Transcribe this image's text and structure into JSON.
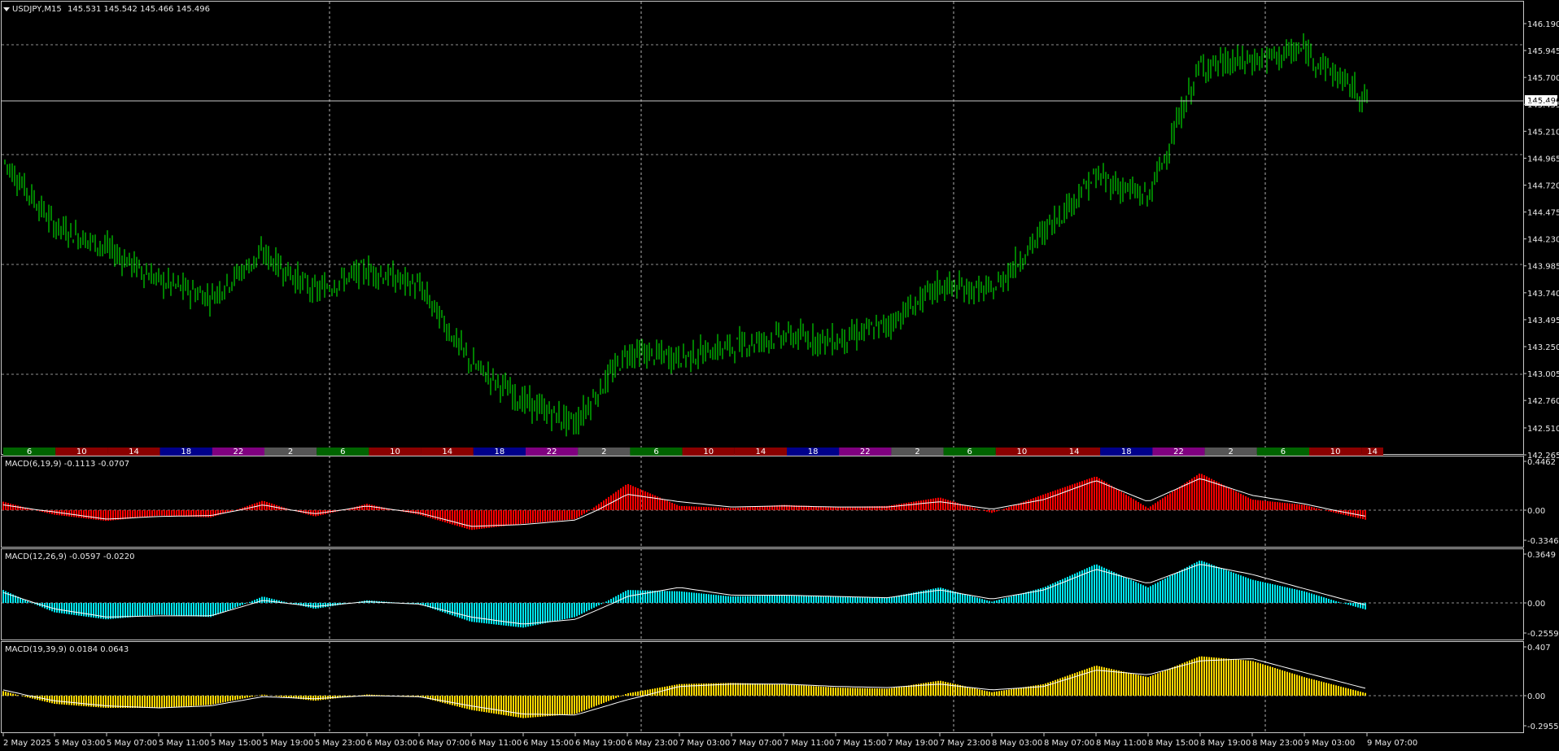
{
  "main_chart": {
    "symbol_label": "USDJPY,M15",
    "ohlc_text": "145.531 145.542 145.466 145.496",
    "current_price_label": "145.496",
    "candle_color": "#00ff00",
    "background": "#000000",
    "y_ticks": [
      "146.190",
      "145.945",
      "145.700",
      "145.455",
      "145.210",
      "144.965",
      "144.720",
      "144.475",
      "144.230",
      "143.985",
      "143.740",
      "143.495",
      "143.250",
      "143.005",
      "142.760",
      "142.510",
      "142.265"
    ]
  },
  "x_axis": {
    "labels": [
      "2 May 2025",
      "5 May 03:00",
      "5 May 07:00",
      "5 May 11:00",
      "5 May 15:00",
      "5 May 19:00",
      "5 May 23:00",
      "6 May 03:00",
      "6 May 07:00",
      "6 May 11:00",
      "6 May 15:00",
      "6 May 19:00",
      "6 May 23:00",
      "7 May 03:00",
      "7 May 07:00",
      "7 May 11:00",
      "7 May 15:00",
      "7 May 19:00",
      "7 May 23:00",
      "8 May 03:00",
      "8 May 07:00",
      "8 May 11:00",
      "8 May 15:00",
      "8 May 19:00",
      "8 May 23:00",
      "9 May 03:00",
      "9 May 07:00"
    ]
  },
  "session_bar": {
    "segments": [
      {
        "label": "6",
        "color": "#006400"
      },
      {
        "label": "10",
        "color": "#8b0000"
      },
      {
        "label": "14",
        "color": "#8b0000"
      },
      {
        "label": "18",
        "color": "#00008b"
      },
      {
        "label": "22",
        "color": "#800080"
      },
      {
        "label": "2",
        "color": "#555555"
      },
      {
        "label": "6",
        "color": "#006400"
      },
      {
        "label": "10",
        "color": "#8b0000"
      },
      {
        "label": "14",
        "color": "#8b0000"
      },
      {
        "label": "18",
        "color": "#00008b"
      },
      {
        "label": "22",
        "color": "#800080"
      },
      {
        "label": "2",
        "color": "#555555"
      },
      {
        "label": "6",
        "color": "#006400"
      },
      {
        "label": "10",
        "color": "#8b0000"
      },
      {
        "label": "14",
        "color": "#8b0000"
      },
      {
        "label": "18",
        "color": "#00008b"
      },
      {
        "label": "22",
        "color": "#800080"
      },
      {
        "label": "2",
        "color": "#555555"
      },
      {
        "label": "6",
        "color": "#006400"
      },
      {
        "label": "10",
        "color": "#8b0000"
      },
      {
        "label": "14",
        "color": "#8b0000"
      },
      {
        "label": "18",
        "color": "#00008b"
      },
      {
        "label": "22",
        "color": "#800080"
      },
      {
        "label": "2",
        "color": "#555555"
      },
      {
        "label": "6",
        "color": "#006400"
      },
      {
        "label": "10",
        "color": "#8b0000"
      },
      {
        "label": "14",
        "color": "#8b0000"
      }
    ]
  },
  "indicators": [
    {
      "name": "MACD(6,19,9) -0.1113 -0.0707",
      "color": "#ff0000",
      "max_label": "0.4462",
      "zero_label": "0.00",
      "min_label": "-0.3346",
      "max": 0.4462,
      "min": -0.3346
    },
    {
      "name": "MACD(12,26,9) -0.0597 -0.0220",
      "color": "#00e5ee",
      "max_label": "0.3649",
      "zero_label": "0.00",
      "min_label": "-0.2559",
      "max": 0.3649,
      "min": -0.2559
    },
    {
      "name": "MACD(19,39,9) 0.0184 0.0643",
      "color": "#ffd700",
      "max_label": "0.407",
      "zero_label": "0.00",
      "min_label": "-0.2955",
      "max": 0.407,
      "min": -0.2955
    }
  ],
  "chart_data": {
    "type": "line",
    "title": "USDJPY,M15",
    "x": [
      "2 May 2025",
      "5 May 03:00",
      "5 May 07:00",
      "5 May 11:00",
      "5 May 15:00",
      "5 May 19:00",
      "5 May 23:00",
      "6 May 03:00",
      "6 May 07:00",
      "6 May 11:00",
      "6 May 15:00",
      "6 May 19:00",
      "6 May 23:00",
      "7 May 03:00",
      "7 May 07:00",
      "7 May 11:00",
      "7 May 15:00",
      "7 May 19:00",
      "7 May 23:00",
      "8 May 03:00",
      "8 May 07:00",
      "8 May 11:00",
      "8 May 15:00",
      "8 May 19:00",
      "8 May 23:00",
      "9 May 03:00",
      "9 May 07:00"
    ],
    "series": [
      {
        "values": [
          144.95,
          144.35,
          144.15,
          143.85,
          143.7,
          144.1,
          143.75,
          143.95,
          143.8,
          143.1,
          142.75,
          142.55,
          143.2,
          143.15,
          143.25,
          143.35,
          143.3,
          143.45,
          143.8,
          143.75,
          144.3,
          144.8,
          144.6,
          145.8,
          145.85,
          145.95,
          145.5
        ]
      }
    ],
    "ylim": [
      142.265,
      146.19
    ],
    "grid": true,
    "indicators": [
      {
        "name": "MACD(6,19,9)",
        "values": [
          0.08,
          -0.05,
          -0.12,
          -0.06,
          -0.08,
          0.09,
          -0.07,
          0.06,
          -0.05,
          -0.22,
          -0.15,
          -0.1,
          0.25,
          0.04,
          0.02,
          0.05,
          0.03,
          0.04,
          0.12,
          -0.03,
          0.15,
          0.32,
          0.02,
          0.35,
          0.1,
          0.05,
          -0.11
        ],
        "signal": [
          0.05,
          -0.02,
          -0.1,
          -0.07,
          -0.06,
          0.05,
          -0.04,
          0.04,
          -0.03,
          -0.18,
          -0.16,
          -0.11,
          0.15,
          0.08,
          0.03,
          0.04,
          0.03,
          0.03,
          0.08,
          0.01,
          0.1,
          0.28,
          0.08,
          0.3,
          0.14,
          0.06,
          -0.07
        ]
      },
      {
        "name": "MACD(12,26,9)",
        "values": [
          0.1,
          -0.08,
          -0.14,
          -0.1,
          -0.12,
          0.05,
          -0.05,
          0.02,
          -0.01,
          -0.16,
          -0.21,
          -0.12,
          0.1,
          0.09,
          0.05,
          0.06,
          0.05,
          0.04,
          0.12,
          0.01,
          0.12,
          0.3,
          0.12,
          0.33,
          0.18,
          0.09,
          -0.06
        ],
        "signal": [
          0.08,
          -0.05,
          -0.12,
          -0.11,
          -0.11,
          0.02,
          -0.03,
          0.01,
          -0.01,
          -0.12,
          -0.18,
          -0.14,
          0.05,
          0.12,
          0.06,
          0.06,
          0.05,
          0.04,
          0.1,
          0.03,
          0.1,
          0.26,
          0.15,
          0.3,
          0.22,
          0.11,
          -0.02
        ]
      },
      {
        "name": "MACD(19,39,9)",
        "values": [
          0.04,
          -0.08,
          -0.12,
          -0.12,
          -0.09,
          0.01,
          -0.05,
          0.01,
          -0.01,
          -0.14,
          -0.22,
          -0.18,
          0.02,
          0.1,
          0.11,
          0.1,
          0.07,
          0.06,
          0.13,
          0.03,
          0.1,
          0.26,
          0.16,
          0.34,
          0.3,
          0.16,
          0.02
        ],
        "signal": [
          0.05,
          -0.05,
          -0.1,
          -0.12,
          -0.1,
          -0.01,
          -0.03,
          0.0,
          -0.01,
          -0.1,
          -0.18,
          -0.19,
          -0.04,
          0.08,
          0.1,
          0.1,
          0.08,
          0.07,
          0.1,
          0.05,
          0.08,
          0.22,
          0.18,
          0.3,
          0.32,
          0.2,
          0.06
        ]
      }
    ]
  }
}
